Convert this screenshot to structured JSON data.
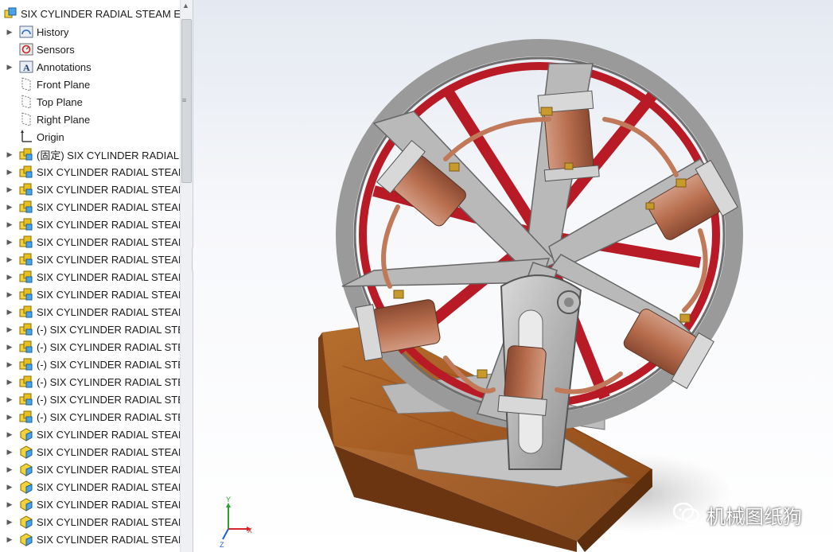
{
  "tree": {
    "root_label": "SIX CYLINDER RADIAL STEAM ENG",
    "items": [
      {
        "label": "History",
        "icon": "history-icon",
        "expandable": true
      },
      {
        "label": "Sensors",
        "icon": "sensors-icon",
        "expandable": false
      },
      {
        "label": "Annotations",
        "icon": "annotations-icon",
        "expandable": true
      },
      {
        "label": "Front Plane",
        "icon": "plane-icon",
        "expandable": false
      },
      {
        "label": "Top Plane",
        "icon": "plane-icon",
        "expandable": false
      },
      {
        "label": "Right Plane",
        "icon": "plane-icon",
        "expandable": false
      },
      {
        "label": "Origin",
        "icon": "origin-icon",
        "expandable": false
      },
      {
        "label": "(固定) SIX CYLINDER RADIAL S",
        "icon": "assembly-icon",
        "expandable": true
      },
      {
        "label": "SIX CYLINDER RADIAL STEAM",
        "icon": "assembly-icon",
        "expandable": true
      },
      {
        "label": "SIX CYLINDER RADIAL STEAM",
        "icon": "assembly-icon",
        "expandable": true
      },
      {
        "label": "SIX CYLINDER RADIAL STEAM",
        "icon": "assembly-icon",
        "expandable": true
      },
      {
        "label": "SIX CYLINDER RADIAL STEAM",
        "icon": "assembly-icon",
        "expandable": true
      },
      {
        "label": "SIX CYLINDER RADIAL STEAM",
        "icon": "assembly-icon",
        "expandable": true
      },
      {
        "label": "SIX CYLINDER RADIAL STEAM",
        "icon": "assembly-icon",
        "expandable": true
      },
      {
        "label": "SIX CYLINDER RADIAL STEAM",
        "icon": "assembly-icon",
        "expandable": true
      },
      {
        "label": "SIX CYLINDER RADIAL STEAM",
        "icon": "assembly-icon",
        "expandable": true
      },
      {
        "label": "SIX CYLINDER RADIAL STEAM",
        "icon": "assembly-icon",
        "expandable": true
      },
      {
        "label": "(-) SIX CYLINDER RADIAL STEA",
        "icon": "assembly-icon",
        "expandable": true
      },
      {
        "label": "(-) SIX CYLINDER RADIAL STEA",
        "icon": "assembly-icon",
        "expandable": true
      },
      {
        "label": "(-) SIX CYLINDER RADIAL STEA",
        "icon": "assembly-icon",
        "expandable": true
      },
      {
        "label": "(-) SIX CYLINDER RADIAL STEA",
        "icon": "assembly-icon",
        "expandable": true
      },
      {
        "label": "(-) SIX CYLINDER RADIAL STEA",
        "icon": "assembly-icon",
        "expandable": true
      },
      {
        "label": "(-) SIX CYLINDER RADIAL STEA",
        "icon": "assembly-icon",
        "expandable": true
      },
      {
        "label": "SIX CYLINDER RADIAL STEAM",
        "icon": "part-icon",
        "expandable": true
      },
      {
        "label": "SIX CYLINDER RADIAL STEAM",
        "icon": "part-icon",
        "expandable": true
      },
      {
        "label": "SIX CYLINDER RADIAL STEAM",
        "icon": "part-icon",
        "expandable": true
      },
      {
        "label": "SIX CYLINDER RADIAL STEAM",
        "icon": "part-icon",
        "expandable": true
      },
      {
        "label": "SIX CYLINDER RADIAL STEAM",
        "icon": "part-icon",
        "expandable": true
      },
      {
        "label": "SIX CYLINDER RADIAL STEAM",
        "icon": "part-icon",
        "expandable": true
      },
      {
        "label": "SIX CYLINDER RADIAL STEAM",
        "icon": "part-icon",
        "expandable": true
      }
    ]
  },
  "triad": {
    "x_label": "X",
    "y_label": "Y",
    "z_label": "Z"
  },
  "watermark": {
    "text": "机械图纸狗"
  },
  "colors": {
    "flywheel": "#b81b25",
    "rim": "#8c8c8c",
    "wood": "#a35a22",
    "copper": "#b86e4e",
    "brass": "#c89a2d"
  }
}
